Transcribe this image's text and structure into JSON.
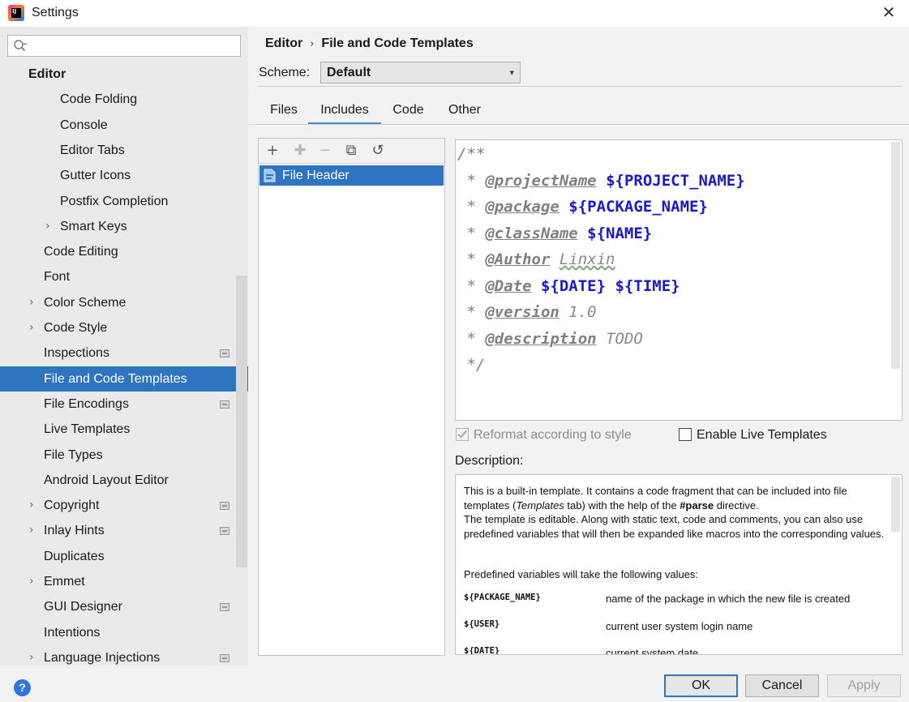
{
  "window": {
    "title": "Settings"
  },
  "search": {
    "placeholder": ""
  },
  "sidebar": {
    "items": [
      {
        "label": "Editor",
        "level": 0,
        "bold": true
      },
      {
        "label": "Code Folding",
        "level": 2
      },
      {
        "label": "Console",
        "level": 2
      },
      {
        "label": "Editor Tabs",
        "level": 2
      },
      {
        "label": "Gutter Icons",
        "level": 2
      },
      {
        "label": "Postfix Completion",
        "level": 2
      },
      {
        "label": "Smart Keys",
        "level": 2,
        "expandable": true
      },
      {
        "label": "Code Editing",
        "level": 1
      },
      {
        "label": "Font",
        "level": 1
      },
      {
        "label": "Color Scheme",
        "level": 1,
        "expandable": true
      },
      {
        "label": "Code Style",
        "level": 1,
        "expandable": true
      },
      {
        "label": "Inspections",
        "level": 1,
        "project": true
      },
      {
        "label": "File and Code Templates",
        "level": 1,
        "selected": true
      },
      {
        "label": "File Encodings",
        "level": 1,
        "project": true
      },
      {
        "label": "Live Templates",
        "level": 1
      },
      {
        "label": "File Types",
        "level": 1
      },
      {
        "label": "Android Layout Editor",
        "level": 1
      },
      {
        "label": "Copyright",
        "level": 1,
        "expandable": true,
        "project": true
      },
      {
        "label": "Inlay Hints",
        "level": 1,
        "expandable": true,
        "project": true
      },
      {
        "label": "Duplicates",
        "level": 1
      },
      {
        "label": "Emmet",
        "level": 1,
        "expandable": true
      },
      {
        "label": "GUI Designer",
        "level": 1,
        "project": true
      },
      {
        "label": "Intentions",
        "level": 1
      },
      {
        "label": "Language Injections",
        "level": 1,
        "expandable": true,
        "project": true
      }
    ]
  },
  "breadcrumb": {
    "parent": "Editor",
    "separator": "›",
    "current": "File and Code Templates"
  },
  "scheme": {
    "label": "Scheme:",
    "value": "Default"
  },
  "tabs": [
    {
      "label": "Files",
      "active": false
    },
    {
      "label": "Includes",
      "active": true
    },
    {
      "label": "Code",
      "active": false
    },
    {
      "label": "Other",
      "active": false
    }
  ],
  "toolbar": {
    "add": "+",
    "add_child": "✚",
    "remove": "−",
    "copy": "⧉",
    "reset": "↺"
  },
  "templates": [
    {
      "label": "File Header",
      "selected": true
    }
  ],
  "code": {
    "line1": "/**",
    "l2_prefix": " * ",
    "l2_tag": "@projectName",
    "l2_var": "${PROJECT_NAME}",
    "l3_prefix": " * ",
    "l3_tag": "@package",
    "l3_var": "${PACKAGE_NAME}",
    "l4_prefix": " * ",
    "l4_tag": "@className",
    "l4_var": "${NAME}",
    "l5_prefix": " * ",
    "l5_tag": "@Author",
    "l5_txt": "Linxin",
    "l6_prefix": " * ",
    "l6_tag": "@Date",
    "l6_var1": "${DATE}",
    "l6_var2": "${TIME}",
    "l7_prefix": " * ",
    "l7_tag": "@version",
    "l7_txt": "1.0",
    "l8_prefix": " * ",
    "l8_tag": "@description",
    "l8_txt": "TODO",
    "line9": " */"
  },
  "options": {
    "reformat": {
      "label": "Reformat according to style",
      "checked": true,
      "disabled": true
    },
    "live_templates": {
      "label": "Enable Live Templates",
      "checked": false
    }
  },
  "description": {
    "label": "Description:",
    "p1_a": "This is a built-in template. It contains a code fragment that can be included into file templates (",
    "p1_b": "Templates",
    "p1_c": " tab) with the help of the ",
    "p1_d": "#parse",
    "p1_e": " directive.",
    "p2": "The template is editable. Along with static text, code and comments, you can also use predefined variables that will then be expanded like macros into the corresponding values.",
    "p3": "Predefined variables will take the following values:",
    "vars": [
      {
        "name": "${PACKAGE_NAME}",
        "desc": "name of the package in which the new file is created"
      },
      {
        "name": "${USER}",
        "desc": "current user system login name"
      },
      {
        "name": "${DATE}",
        "desc": "current system date"
      }
    ]
  },
  "buttons": {
    "help": "?",
    "ok": "OK",
    "cancel": "Cancel",
    "apply": "Apply"
  }
}
